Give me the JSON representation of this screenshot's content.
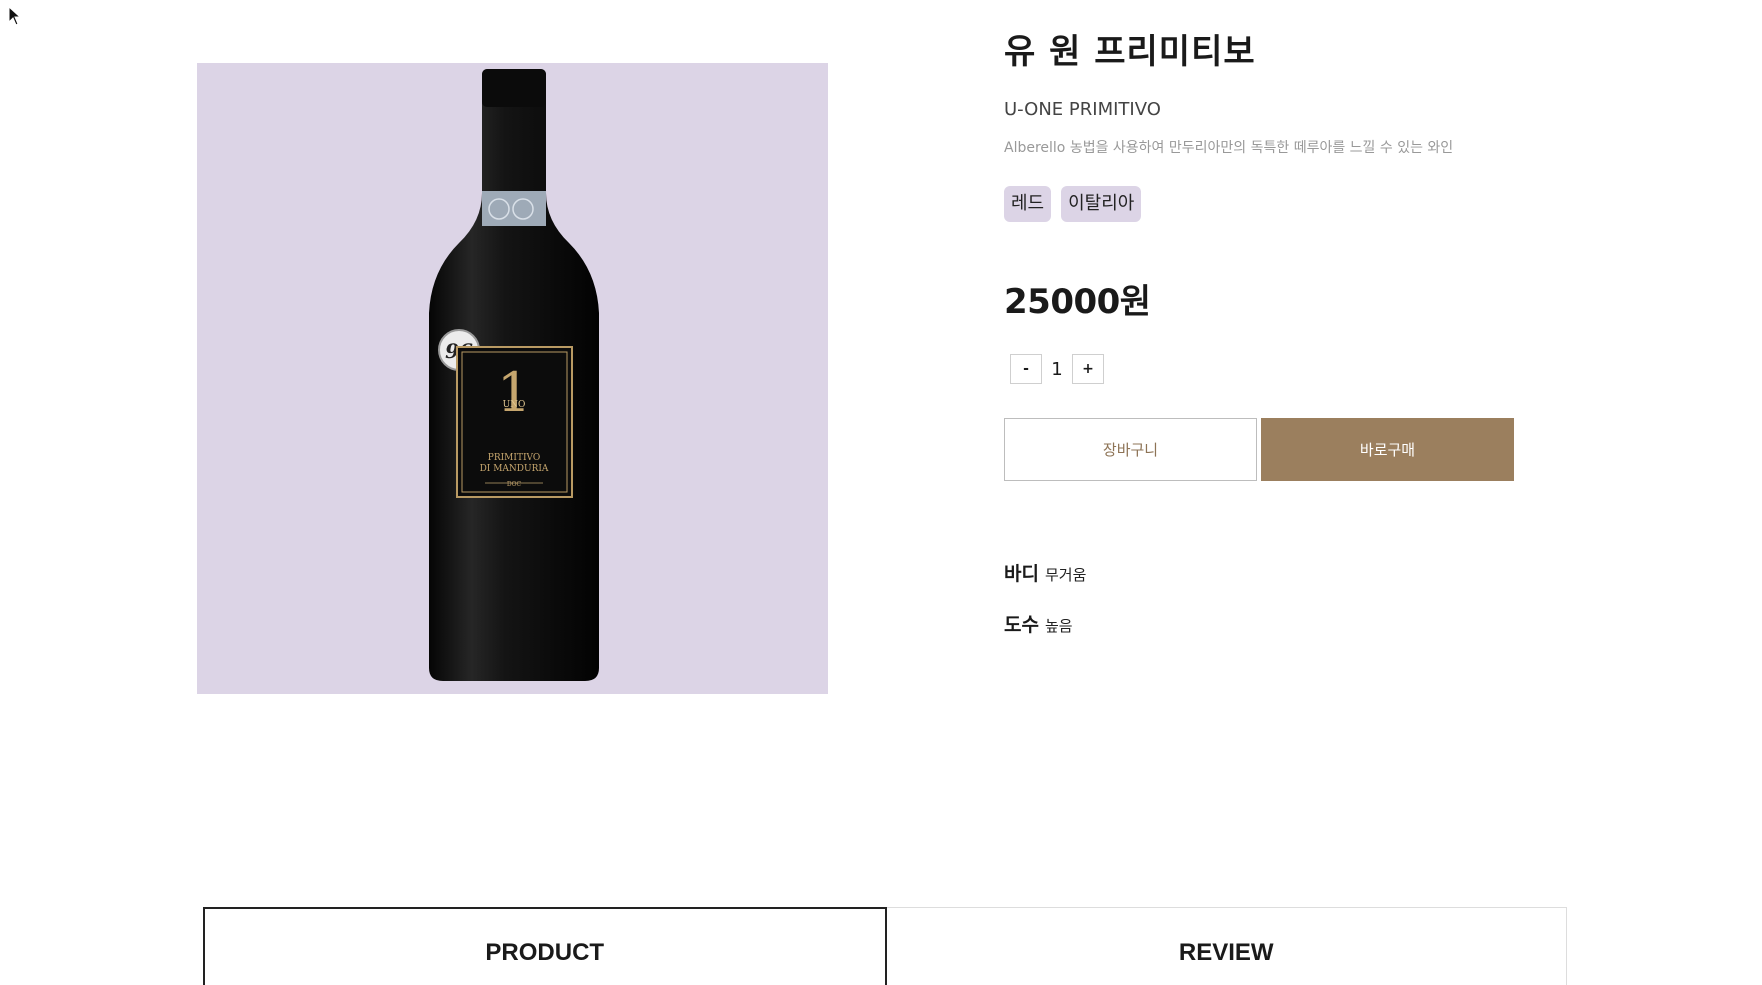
{
  "product": {
    "name_ko": "유 원 프리미티보",
    "name_en": "U-ONE PRIMITIVO",
    "description": "Alberello 농법을 사용하여 만두리아만의 독특한 떼루아를 느낄 수 있는 와인",
    "tags": [
      "레드",
      "이탈리아"
    ],
    "price": "25000원",
    "image_bg_color": "#dcd4e6",
    "label": {
      "score": "96",
      "number": "1",
      "uno": "UNO",
      "line1": "PRIMITIVO",
      "line2": "DI MANDURIA",
      "line3": "DOC"
    }
  },
  "quantity": {
    "minus_label": "-",
    "value": "1",
    "plus_label": "+"
  },
  "actions": {
    "cart_label": "장바구니",
    "buy_label": "바로구매",
    "buy_color": "#9b7f5e"
  },
  "specs": [
    {
      "label": "바디",
      "value": "무거움"
    },
    {
      "label": "도수",
      "value": "높음"
    }
  ],
  "tabs": [
    {
      "label": "PRODUCT",
      "active": true
    },
    {
      "label": "REVIEW",
      "active": false
    }
  ]
}
